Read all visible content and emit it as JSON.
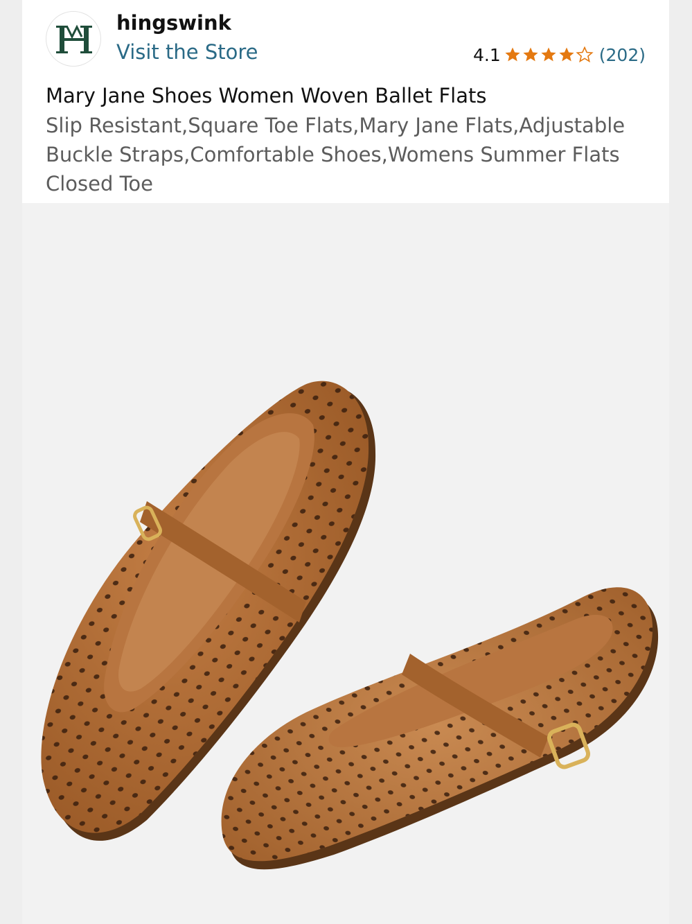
{
  "store": {
    "name": "hingswink",
    "visit_label": "Visit the Store",
    "logo_icon": "hingswink-logo-icon"
  },
  "rating": {
    "value": "4.1",
    "stars_out_of_5": 4.1,
    "review_count": "(202)",
    "star_color": "#e47911"
  },
  "product": {
    "title": "Mary Jane Shoes Women Woven Ballet Flats",
    "subtitle": "Slip Resistant,Square Toe Flats,Mary Jane Flats,Adjustable Buckle Straps,Comfortable Shoes,Womens Summer Flats Closed Toe",
    "image_icon": "product-photo-brown-perforated-mary-jane-flats"
  },
  "colors": {
    "link": "#2a6a86",
    "logo": "#1f4d3a",
    "shoe": "#b06a34"
  }
}
